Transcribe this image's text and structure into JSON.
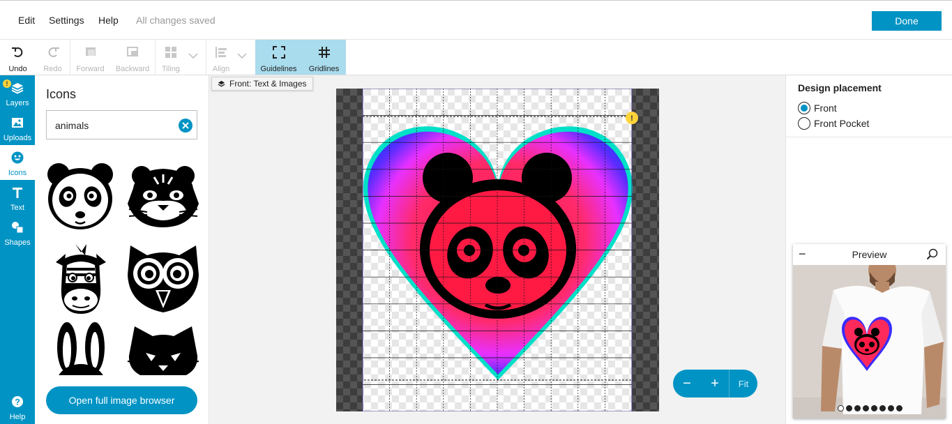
{
  "menu": {
    "items": [
      "Edit",
      "Settings",
      "Help"
    ],
    "status": "All changes saved",
    "done_label": "Done"
  },
  "toolbar": {
    "undo": "Undo",
    "redo": "Redo",
    "forward": "Forward",
    "backward": "Backward",
    "tiling": "Tiling",
    "align": "Align",
    "guidelines": "Guidelines",
    "gridlines": "Gridlines"
  },
  "rail": {
    "layers": "Layers",
    "uploads": "Uploads",
    "icons": "Icons",
    "text": "Text",
    "shapes": "Shapes",
    "help": "Help",
    "warning_mark": "!"
  },
  "panel": {
    "title": "Icons",
    "search_value": "animals",
    "open_browser": "Open full image browser",
    "icon_names": [
      "panda-icon",
      "tiger-icon",
      "zebra-icon",
      "owl-icon",
      "rabbit-icon",
      "cat-icon"
    ]
  },
  "canvas": {
    "side_tag": "Front: Text & Images",
    "warning_mark": "!",
    "zoom_out": "−",
    "zoom_in": "+",
    "fit": "Fit"
  },
  "placement": {
    "title": "Design placement",
    "options": [
      {
        "label": "Front",
        "selected": true
      },
      {
        "label": "Front Pocket",
        "selected": false
      }
    ]
  },
  "preview": {
    "title": "Preview",
    "collapse": "−",
    "dot_count": 8,
    "active_dot": 0
  },
  "colors": {
    "accent": "#0093c4",
    "active_tool": "#a9dced",
    "heart_center": "#ff2a55",
    "heart_edge": "#5a2cff"
  }
}
